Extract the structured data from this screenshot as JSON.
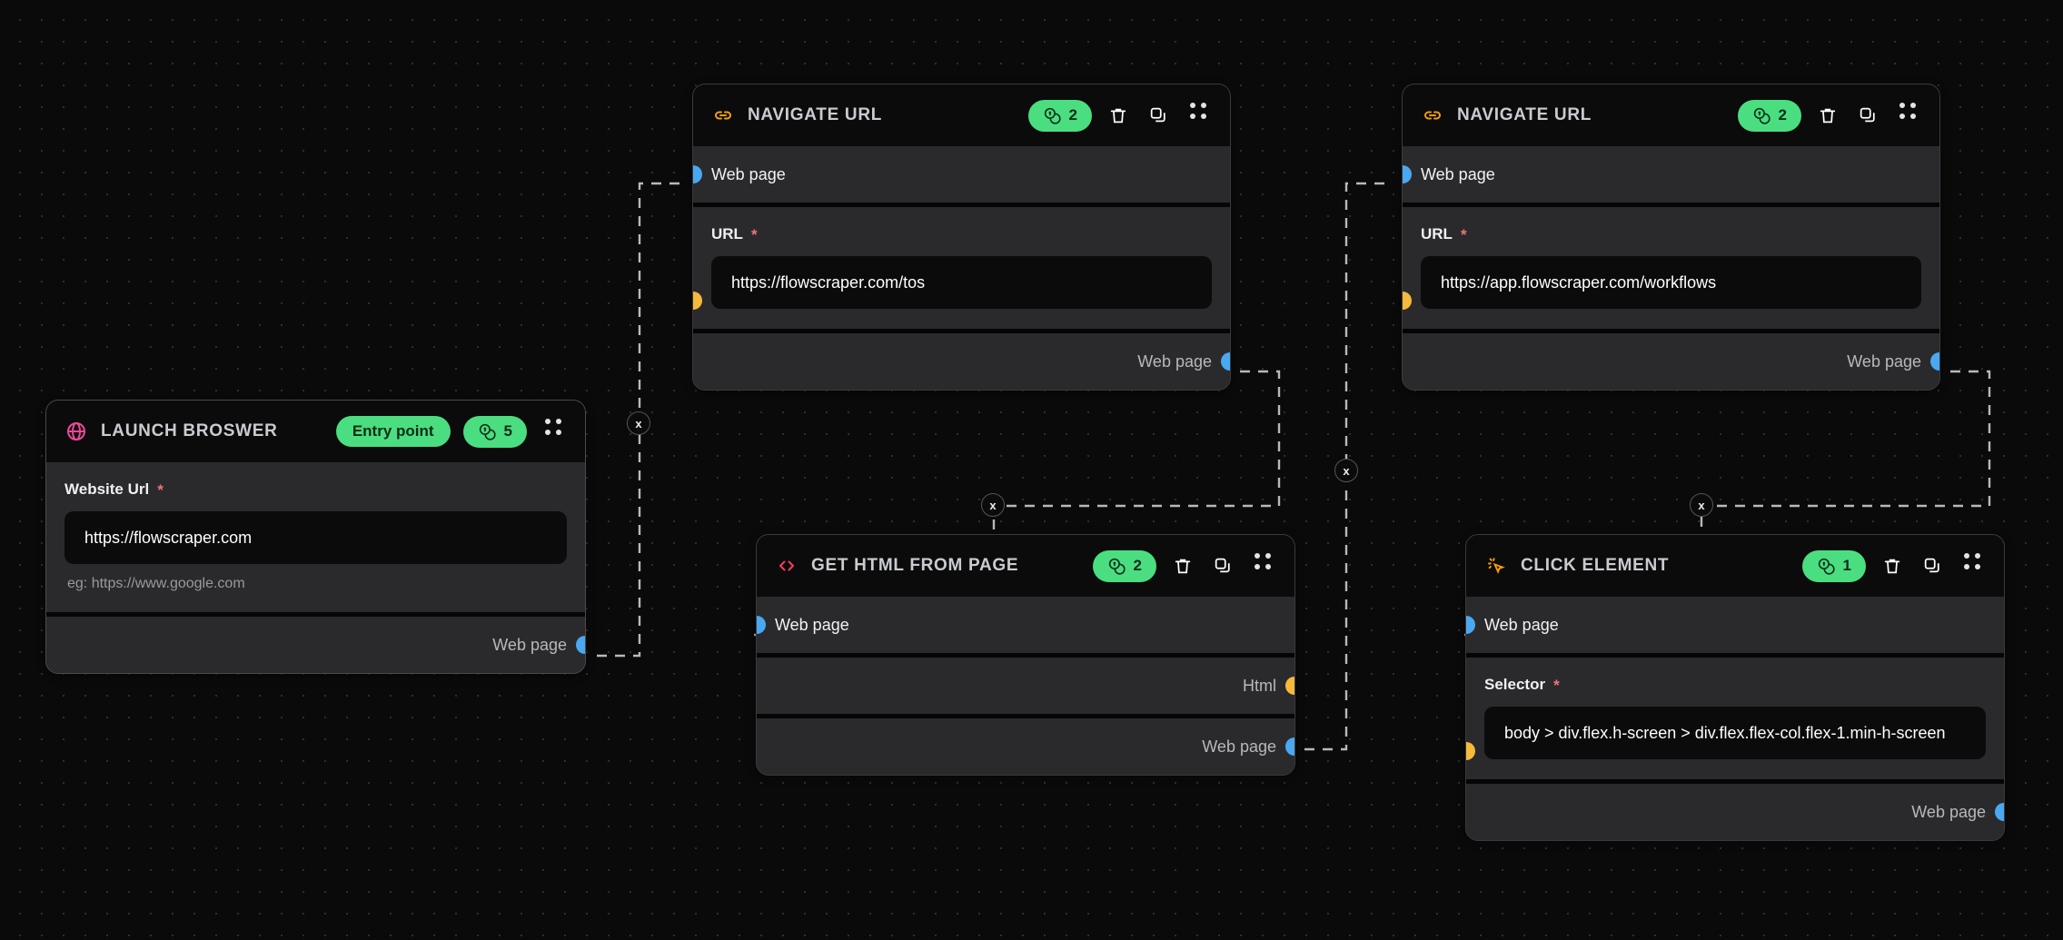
{
  "canvas": {
    "background": "#0a0a0a",
    "dot_color": "#2e2e2e"
  },
  "colors": {
    "accent_green": "#4ade80",
    "handle_web_page": "#4aa8f0",
    "handle_data": "#f5b93c",
    "required_marker": "#f27272",
    "icon_navigate": "#f59e0b",
    "icon_launch": "#ec4899",
    "icon_gethtml": "#f43f5e",
    "icon_click": "#f59e0b"
  },
  "edge_delete_label": "x",
  "nodes": [
    {
      "id": "launch-browser",
      "title": "LAUNCH BROSWER",
      "icon": "globe-icon",
      "entry_badge": "Entry point",
      "credits": "5",
      "inputs": [],
      "fields": [
        {
          "label": "Website Url",
          "required": "*",
          "value": "https://flowscraper.com",
          "placeholder": "eg: https://www.google.com",
          "hint": "eg: https://www.google.com"
        }
      ],
      "outputs": [
        {
          "label": "Web page",
          "handle": "blue"
        }
      ]
    },
    {
      "id": "navigate-url-1",
      "title": "NAVIGATE URL",
      "icon": "link-icon",
      "credits": "2",
      "inputs": [
        {
          "label": "Web page",
          "handle": "blue"
        }
      ],
      "fields": [
        {
          "label": "URL",
          "required": "*",
          "value": "https://flowscraper.com/tos",
          "handle": "yellow"
        }
      ],
      "outputs": [
        {
          "label": "Web page",
          "handle": "blue"
        }
      ]
    },
    {
      "id": "navigate-url-2",
      "title": "NAVIGATE URL",
      "icon": "link-icon",
      "credits": "2",
      "inputs": [
        {
          "label": "Web page",
          "handle": "blue"
        }
      ],
      "fields": [
        {
          "label": "URL",
          "required": "*",
          "value": "https://app.flowscraper.com/workflows",
          "handle": "yellow"
        }
      ],
      "outputs": [
        {
          "label": "Web page",
          "handle": "blue"
        }
      ]
    },
    {
      "id": "get-html-from-page",
      "title": "GET HTML FROM PAGE",
      "icon": "code-icon",
      "credits": "2",
      "inputs": [
        {
          "label": "Web page",
          "handle": "blue"
        }
      ],
      "fields": [],
      "outputs": [
        {
          "label": "Html",
          "handle": "yellow"
        },
        {
          "label": "Web page",
          "handle": "blue"
        }
      ]
    },
    {
      "id": "click-element",
      "title": "CLICK ELEMENT",
      "icon": "mouse-pointer-click-icon",
      "credits": "1",
      "inputs": [
        {
          "label": "Web page",
          "handle": "blue"
        }
      ],
      "fields": [
        {
          "label": "Selector",
          "required": "*",
          "value": "body > div.flex.h-screen > div.flex.flex-col.flex-1.min-h-screen",
          "handle": "yellow"
        }
      ],
      "outputs": [
        {
          "label": "Web page",
          "handle": "blue"
        }
      ]
    }
  ],
  "toolbar": {
    "delete_icon": "trash-icon",
    "copy_icon": "copy-icon",
    "drag_icon": "grip-dots-icon"
  }
}
